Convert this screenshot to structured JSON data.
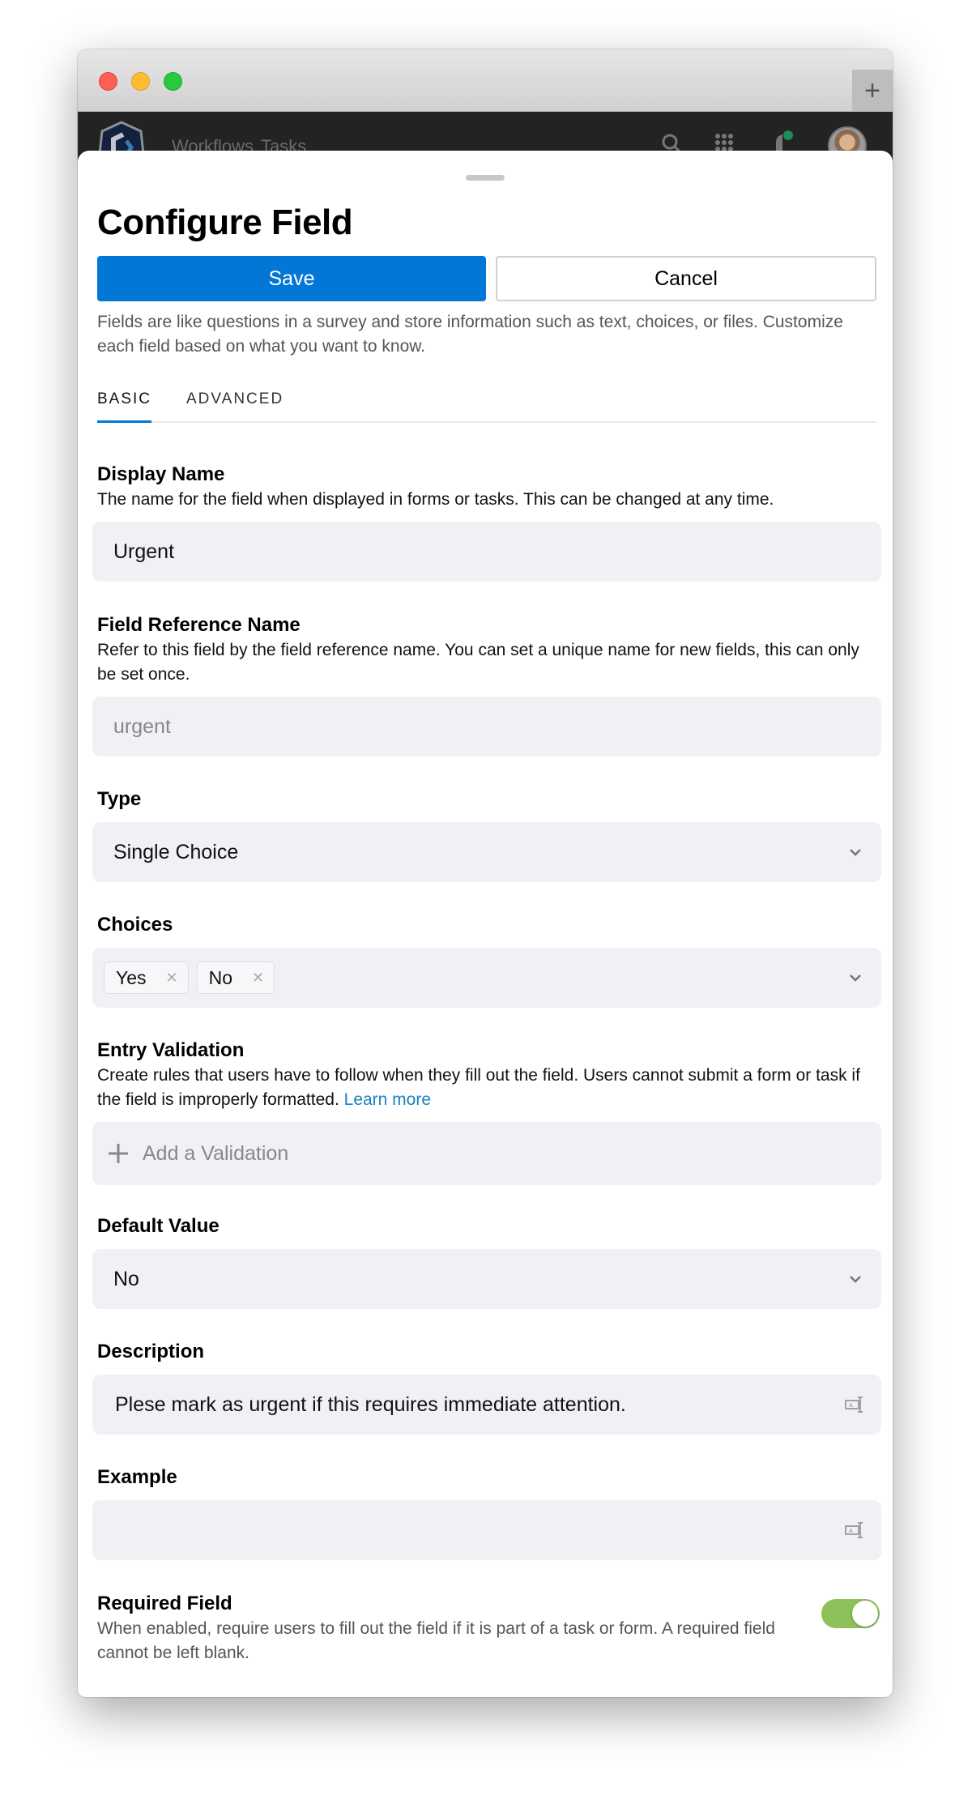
{
  "browser": {
    "new_tab_icon": "plus-icon"
  },
  "app_nav": {
    "links": [
      "Workflows",
      "Tasks"
    ],
    "icons": [
      "search-icon",
      "apps-grid-icon",
      "notifications-icon",
      "avatar"
    ],
    "notification_dot_color": "#1f8a5a"
  },
  "sheet": {
    "title": "Configure Field",
    "save_label": "Save",
    "cancel_label": "Cancel",
    "intro": "Fields are like questions in a survey and store information such as text, choices, or files. Customize each field based on what you want to know.",
    "tabs": [
      {
        "label": "BASIC",
        "active": true
      },
      {
        "label": "ADVANCED",
        "active": false
      }
    ]
  },
  "form": {
    "display_name": {
      "label": "Display Name",
      "help": "The name for the field when displayed in forms or tasks. This can be changed at any time.",
      "value": "Urgent"
    },
    "reference_name": {
      "label": "Field Reference Name",
      "help": "Refer to this field by the field reference name. You can set a unique name for new fields, this can only be set once.",
      "value": "urgent"
    },
    "type": {
      "label": "Type",
      "value": "Single Choice"
    },
    "choices": {
      "label": "Choices",
      "items": [
        "Yes",
        "No"
      ]
    },
    "entry_validation": {
      "label": "Entry Validation",
      "help": "Create rules that users have to follow when they fill out the field. Users cannot submit a form or task if the field is improperly formatted.",
      "link": "Learn more",
      "add_label": "Add a Validation"
    },
    "default_value": {
      "label": "Default Value",
      "value": "No"
    },
    "description": {
      "label": "Description",
      "value": "Plese mark as urgent if this requires immediate attention."
    },
    "example": {
      "label": "Example",
      "value": ""
    },
    "required": {
      "label": "Required Field",
      "help": "When enabled, require users to fill out the field if it is part of a task or form. A required field cannot be left blank.",
      "enabled": true
    }
  },
  "colors": {
    "primary": "#0277d6",
    "toggle_on": "#8dc15a",
    "link": "#1a7fc1",
    "field_bg": "#f0f1f5"
  }
}
